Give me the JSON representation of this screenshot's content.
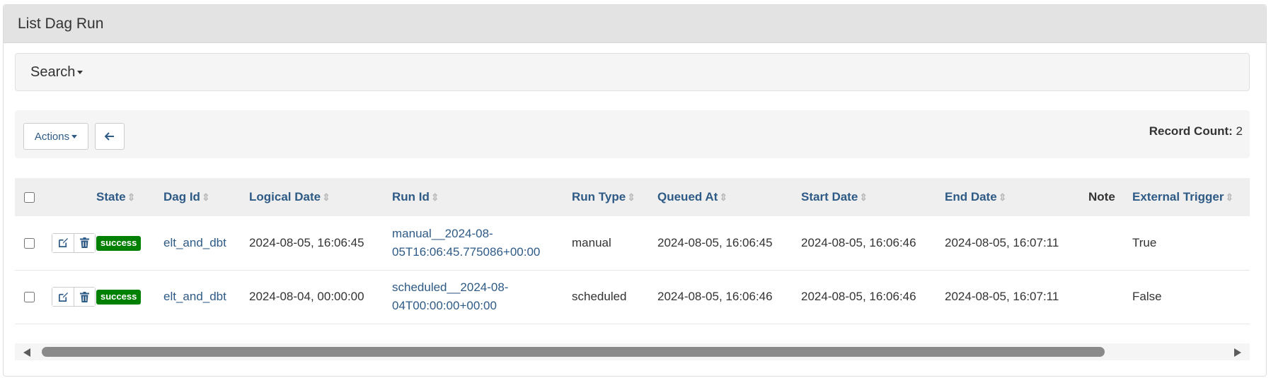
{
  "panel": {
    "title": "List Dag Run"
  },
  "search": {
    "label": "Search"
  },
  "toolbar": {
    "actions_label": "Actions",
    "back_icon": "arrow-left-icon",
    "record_count_label": "Record Count:",
    "record_count_value": "2"
  },
  "table": {
    "headers": {
      "state": "State",
      "dag_id": "Dag Id",
      "logical_date": "Logical Date",
      "run_id": "Run Id",
      "run_type": "Run Type",
      "queued_at": "Queued At",
      "start_date": "Start Date",
      "end_date": "End Date",
      "note": "Note",
      "external_trigger": "External Trigger"
    },
    "rows": [
      {
        "state": "success",
        "dag_id": "elt_and_dbt",
        "logical_date": "2024-08-05, 16:06:45",
        "run_id_line1": "manual__2024-08-",
        "run_id_line2": "05T16:06:45.775086+00:00",
        "run_type": "manual",
        "queued_at": "2024-08-05, 16:06:45",
        "start_date": "2024-08-05, 16:06:46",
        "end_date": "2024-08-05, 16:07:11",
        "note": "",
        "external_trigger": "True"
      },
      {
        "state": "success",
        "dag_id": "elt_and_dbt",
        "logical_date": "2024-08-04, 00:00:00",
        "run_id_line1": "scheduled__2024-08-",
        "run_id_line2": "04T00:00:00+00:00",
        "run_type": "scheduled",
        "queued_at": "2024-08-05, 16:06:46",
        "start_date": "2024-08-05, 16:06:46",
        "end_date": "2024-08-05, 16:07:11",
        "note": "",
        "external_trigger": "False"
      }
    ]
  },
  "colors": {
    "link": "#2e5a86",
    "success_badge": "#008000",
    "header_bg": "#e3e3e3",
    "well_bg": "#f5f5f5"
  }
}
